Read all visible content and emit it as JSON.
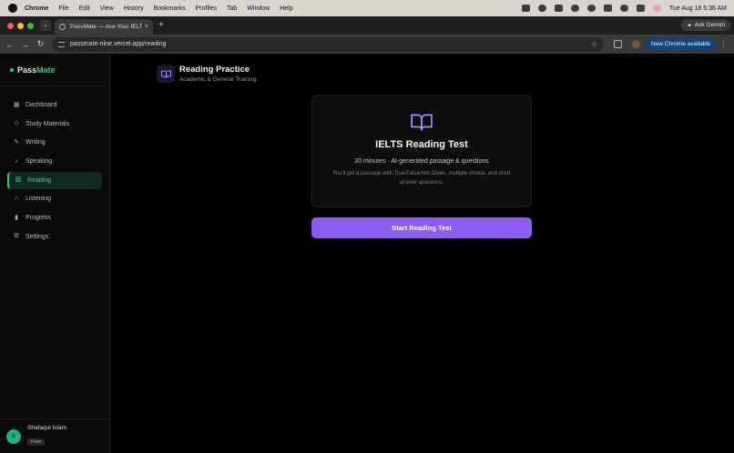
{
  "menubar": {
    "app": "Chrome",
    "items": [
      "File",
      "Edit",
      "View",
      "History",
      "Bookmarks",
      "Profiles",
      "Tab",
      "Window",
      "Help"
    ],
    "clock": "Tue Aug 18  5:36 AM"
  },
  "browser": {
    "tab_title": "PassMate — Ace Your IELTS w",
    "ask_gemini": "Ask Gemini",
    "url": "passmate-nine.vercel.app/reading",
    "update_label": "New Chrome available"
  },
  "brand": {
    "pass": "Pass",
    "mate": "Mate",
    "accent": "#2bd27a"
  },
  "sidebar": {
    "items": [
      {
        "label": "Dashboard",
        "icon": "dashboard-icon"
      },
      {
        "label": "Study Materials",
        "icon": "graduation-cap-icon"
      },
      {
        "label": "Writing",
        "icon": "pen-icon"
      },
      {
        "label": "Speaking",
        "icon": "microphone-icon"
      },
      {
        "label": "Reading",
        "icon": "book-icon",
        "active": true
      },
      {
        "label": "Listening",
        "icon": "headphones-icon"
      },
      {
        "label": "Progress",
        "icon": "bar-chart-icon"
      },
      {
        "label": "Settings",
        "icon": "gear-icon"
      }
    ]
  },
  "user": {
    "initial": "S",
    "name": "Shafaqul Islam",
    "plan": "Free"
  },
  "header": {
    "title": "Reading Practice",
    "subtitle": "Academic & General Training"
  },
  "card": {
    "title": "IELTS Reading Test",
    "meta": "20 minutes · AI-generated passage & questions",
    "description": "You'll get a passage with True/False/Not Given, multiple choice, and short answer questions."
  },
  "start_button": "Start Reading Test",
  "colors": {
    "primary": "#8b5cf6",
    "accent": "#2bd27a"
  }
}
